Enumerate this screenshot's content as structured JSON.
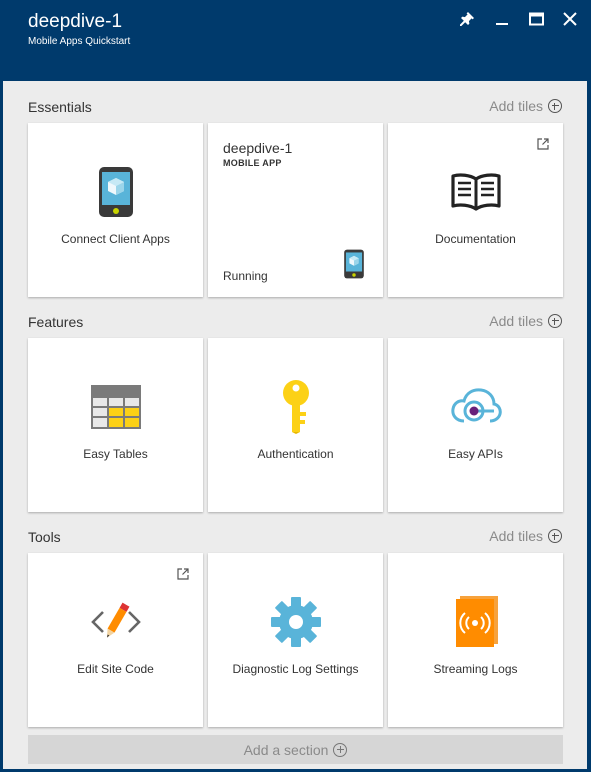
{
  "header": {
    "title": "deepdive-1",
    "subtitle": "Mobile Apps Quickstart",
    "controls": [
      "pin-icon",
      "minimize-icon",
      "maximize-icon",
      "close-icon"
    ]
  },
  "sections": {
    "essentials": {
      "title": "Essentials",
      "add_tiles": "Add tiles"
    },
    "features": {
      "title": "Features",
      "add_tiles": "Add tiles"
    },
    "tools": {
      "title": "Tools",
      "add_tiles": "Add tiles"
    }
  },
  "tiles": {
    "connect": {
      "label": "Connect Client Apps",
      "icon": "phone-cube-icon"
    },
    "app": {
      "name": "deepdive-1",
      "type": "MOBILE APP",
      "status": "Running",
      "icon": "phone-cube-icon"
    },
    "docs": {
      "label": "Documentation",
      "icon": "book-icon"
    },
    "tables": {
      "label": "Easy Tables",
      "icon": "table-icon"
    },
    "auth": {
      "label": "Authentication",
      "icon": "key-icon"
    },
    "apis": {
      "label": "Easy APIs",
      "icon": "cloud-api-icon"
    },
    "code": {
      "label": "Edit Site Code",
      "icon": "code-pencil-icon"
    },
    "diag": {
      "label": "Diagnostic Log Settings",
      "icon": "gear-icon"
    },
    "stream": {
      "label": "Streaming Logs",
      "icon": "broadcast-book-icon"
    }
  },
  "footer": {
    "add_section": "Add a section"
  },
  "colors": {
    "header": "#003a6c",
    "background": "#ececec",
    "tile": "#ffffff",
    "accent_blue": "#59b4d9",
    "accent_yellow": "#fcd116",
    "accent_orange": "#ff8c00",
    "accent_purple": "#68217a"
  }
}
